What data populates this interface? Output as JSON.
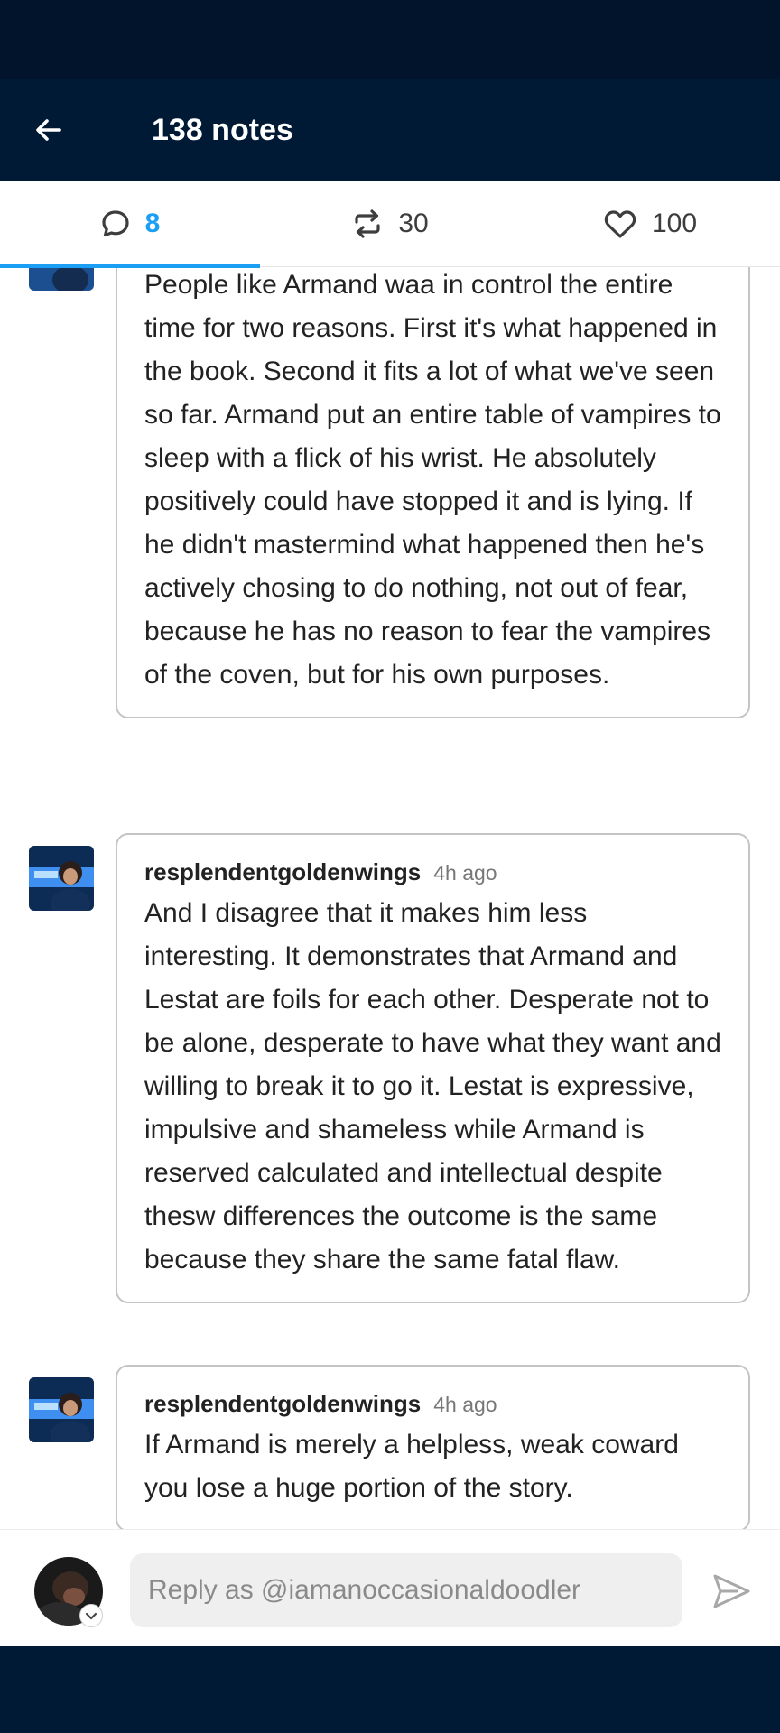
{
  "header": {
    "title": "138 notes"
  },
  "tabs": [
    {
      "id": "replies",
      "count": "8",
      "active": true,
      "icon": "comment-icon"
    },
    {
      "id": "reblogs",
      "count": "30",
      "active": false,
      "icon": "reblog-icon"
    },
    {
      "id": "likes",
      "count": "100",
      "active": false,
      "icon": "heart-icon"
    }
  ],
  "notes": [
    {
      "username": "",
      "time": "",
      "text": "People like Armand waa in control the entire time for two reasons.  First it's what happened in the book. Second it fits a lot of what we've seen so far. Armand put an entire table of vampires to sleep with a flick of his wrist. He absolutely positively could have stopped it and is lying. If he didn't mastermind what happened then he's actively chosing to do nothing, not out of fear, because he has no reason to fear the vampires of the coven, but for his own purposes."
    },
    {
      "username": "resplendentgoldenwings",
      "time": "4h ago",
      "text": "And I disagree that it makes him less interesting. It demonstrates that Armand and Lestat are foils for each other. Desperate not to be alone, desperate to have what they want and willing to break it to go it. Lestat is expressive, impulsive and shameless while Armand is reserved calculated and intellectual despite thesw differences the outcome is the same because they share the same fatal flaw."
    },
    {
      "username": "resplendentgoldenwings",
      "time": "4h ago",
      "text": "If Armand is merely a helpless, weak coward you lose a huge portion of the story."
    }
  ],
  "reply": {
    "placeholder": "Reply as @iamanoccasionaldoodler"
  },
  "colors": {
    "navy": "#001935",
    "accent": "#1a9ff5",
    "border": "#c4c4c4"
  }
}
